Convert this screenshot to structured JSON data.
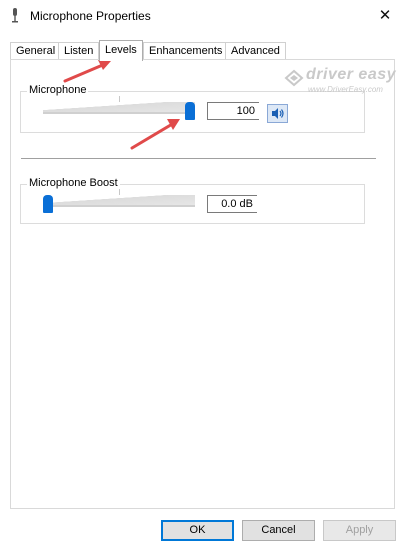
{
  "window": {
    "title": "Microphone Properties"
  },
  "tabs": [
    {
      "label": "General"
    },
    {
      "label": "Listen"
    },
    {
      "label": "Levels"
    },
    {
      "label": "Enhancements"
    },
    {
      "label": "Advanced"
    }
  ],
  "active_tab": "Levels",
  "microphone": {
    "label": "Microphone",
    "value_text": "100",
    "level_percent": 100
  },
  "boost": {
    "label": "Microphone Boost",
    "value_text": "0.0 dB",
    "level_percent": 0
  },
  "buttons": {
    "ok": "OK",
    "cancel": "Cancel",
    "apply": "Apply"
  },
  "watermark": {
    "brand": "driver easy",
    "url": "www.DriverEasy.com"
  },
  "colors": {
    "accent": "#0078d7",
    "slider_thumb": "#0a6fd6",
    "annotation_arrow": "#e04a4a"
  }
}
